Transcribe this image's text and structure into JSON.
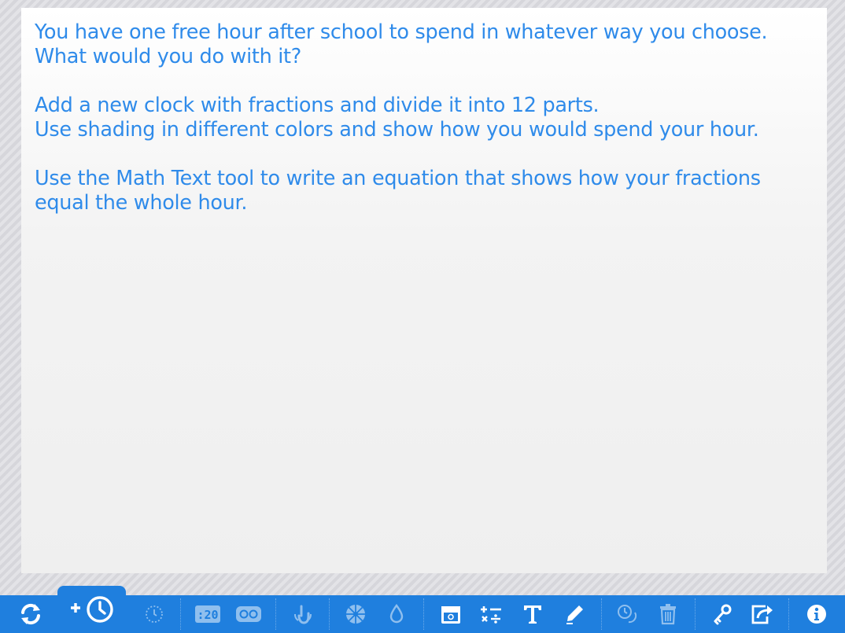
{
  "instructions": {
    "paragraph1": {
      "line1": "You have one free hour after school to spend in whatever way you choose.",
      "line2": "What would you do with it?"
    },
    "paragraph2": {
      "line1": "Add a new clock with fractions and divide it into 12 parts.",
      "line2": "Use shading in different colors and show how you would spend your hour."
    },
    "paragraph3": {
      "line1": "Use the Math Text tool to write an equation that shows how your fractions",
      "line2": "equal the whole hour."
    }
  },
  "toolbar": {
    "digital_readout": ":20",
    "buttons": [
      {
        "icon": "refresh-icon",
        "enabled": true
      },
      {
        "icon": "add-clock-icon",
        "enabled": true
      },
      {
        "icon": "clock-ticks-icon",
        "enabled": false
      },
      {
        "icon": "digital-clock-icon",
        "enabled": false
      },
      {
        "icon": "time-span-icon",
        "enabled": false
      },
      {
        "icon": "rotate-hand-icon",
        "enabled": false
      },
      {
        "icon": "fraction-pie-icon",
        "enabled": false
      },
      {
        "icon": "fill-drop-icon",
        "enabled": false
      },
      {
        "icon": "calendar-icon",
        "enabled": true
      },
      {
        "icon": "math-text-icon",
        "enabled": true
      },
      {
        "icon": "text-tool-icon",
        "enabled": true
      },
      {
        "icon": "pen-icon",
        "enabled": true
      },
      {
        "icon": "duplicate-clock-icon",
        "enabled": false
      },
      {
        "icon": "trash-icon",
        "enabled": false
      },
      {
        "icon": "key-icon",
        "enabled": true
      },
      {
        "icon": "share-icon",
        "enabled": true
      },
      {
        "icon": "info-icon",
        "enabled": true
      }
    ]
  },
  "colors": {
    "text": "#2f8bea",
    "toolbar": "#1f7fde",
    "icon": "#ffffff"
  }
}
